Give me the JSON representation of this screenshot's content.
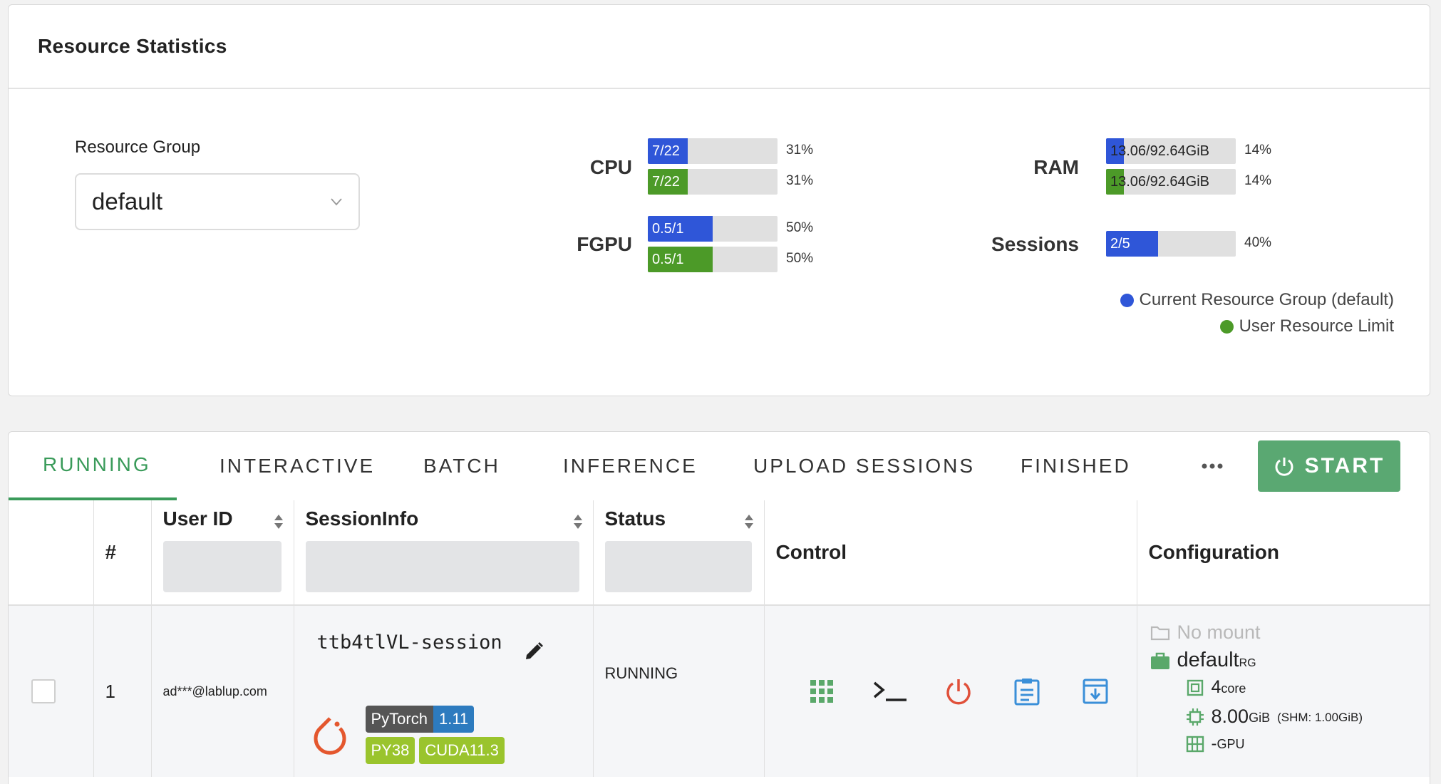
{
  "stats": {
    "title": "Resource Statistics",
    "resource_group_label": "Resource Group",
    "resource_group_value": "default",
    "cpu": {
      "label": "CPU",
      "current_text": "7/22",
      "limit_text": "7/22",
      "current_pct": "31%",
      "limit_pct": "31%",
      "current_fraction": 0.31,
      "limit_fraction": 0.31
    },
    "fgpu": {
      "label": "FGPU",
      "current_text": "0.5/1",
      "limit_text": "0.5/1",
      "current_pct": "50%",
      "limit_pct": "50%",
      "current_fraction": 0.5,
      "limit_fraction": 0.5
    },
    "ram": {
      "label": "RAM",
      "current_text": "13.06/92.64GiB",
      "limit_text": "13.06/92.64GiB",
      "current_pct": "14%",
      "limit_pct": "14%",
      "current_fraction": 0.14,
      "limit_fraction": 0.14
    },
    "sessions": {
      "label": "Sessions",
      "current_text": "2/5",
      "current_pct": "40%",
      "current_fraction": 0.4
    },
    "legend": {
      "current": "Current Resource Group (default)",
      "limit": "User Resource Limit"
    },
    "colors": {
      "current": "#2f56d8",
      "limit": "#4c9a28"
    }
  },
  "tabs": [
    "RUNNING",
    "INTERACTIVE",
    "BATCH",
    "INFERENCE",
    "UPLOAD SESSIONS",
    "FINISHED"
  ],
  "active_tab": "RUNNING",
  "start_label": "START",
  "table": {
    "headers": {
      "index": "#",
      "user": "User ID",
      "session": "SessionInfo",
      "status": "Status",
      "control": "Control",
      "config": "Configuration"
    },
    "rows": [
      {
        "index": "1",
        "user": "ad***@lablup.com",
        "session_name": "ttb4tlVL-session",
        "tags": {
          "framework": "PyTorch",
          "version": "1.11",
          "python": "PY38",
          "cuda": "CUDA11.3"
        },
        "status": "RUNNING",
        "config": {
          "mount": "No mount",
          "rg_name": "default",
          "rg_suffix": "RG",
          "cpu_value": "4",
          "cpu_unit": "core",
          "mem_value": "8.00",
          "mem_unit": "GiB",
          "shm": "(SHM: 1.00GiB)",
          "gpu_value": "-",
          "gpu_unit": "GPU"
        }
      }
    ]
  },
  "accent": "#3a9b5a"
}
